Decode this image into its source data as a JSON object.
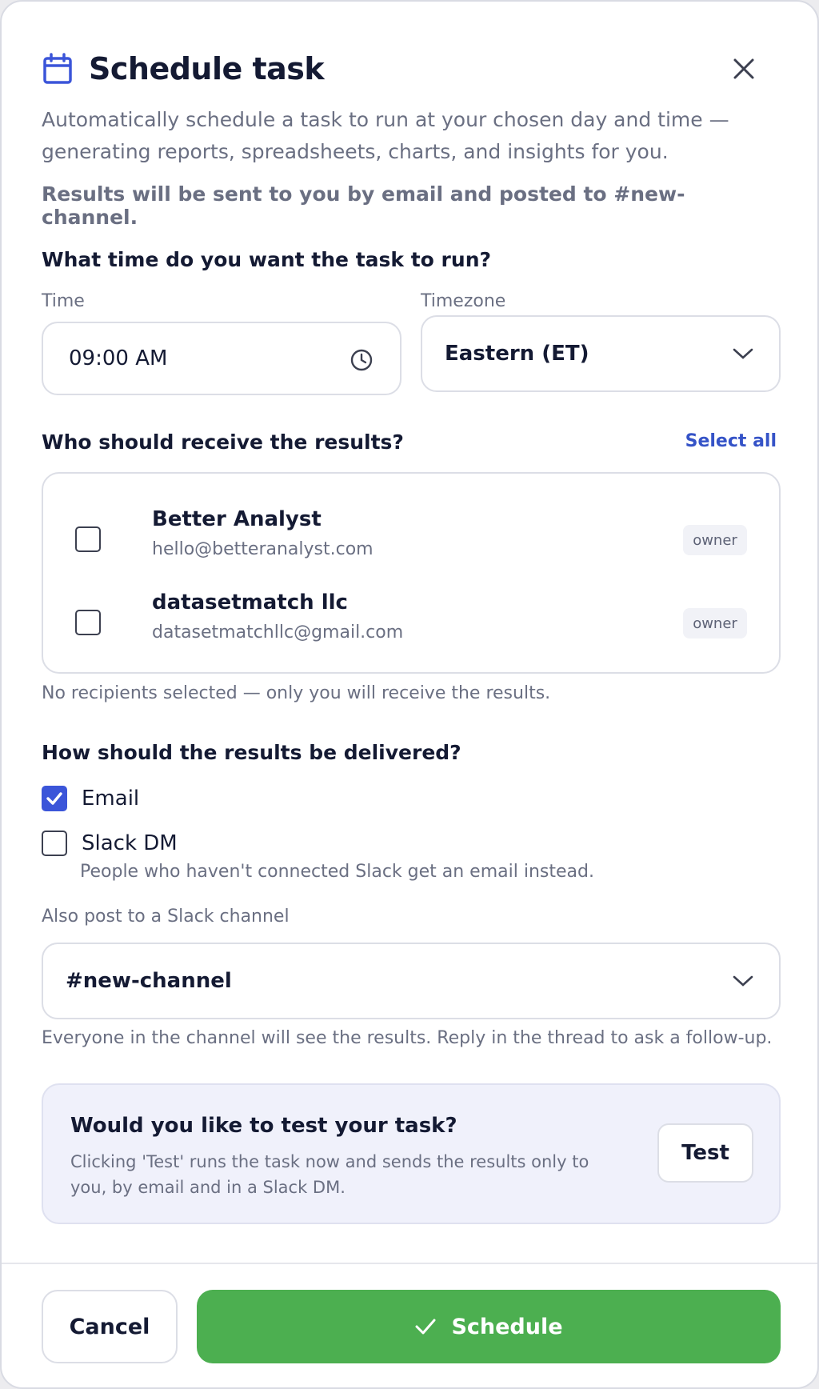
{
  "header": {
    "title": "Schedule task",
    "icons": {
      "calendar": "calendar-icon",
      "close": "close-icon"
    }
  },
  "description": "Automatically schedule a task to run at your chosen day and time — generating reports, spreadsheets, charts, and insights for you.",
  "results_note": "Results will be sent to you by email and posted to #new-channel.",
  "time_section": {
    "heading": "What time do you want the task to run?",
    "time_label": "Time",
    "time_value": "09:00 AM",
    "timezone_label": "Timezone",
    "timezone_value": "Eastern (ET)"
  },
  "recipients": {
    "heading": "Who should receive the results?",
    "select_all": "Select all",
    "items": [
      {
        "name": "Better Analyst",
        "email": "hello@betteranalyst.com",
        "role": "owner",
        "checked": false
      },
      {
        "name": "datasetmatch llc",
        "email": "datasetmatchllc@gmail.com",
        "role": "owner",
        "checked": false
      }
    ],
    "hint": "No recipients selected — only you will receive the results."
  },
  "delivery": {
    "heading": "How should the results be delivered?",
    "email_label": "Email",
    "email_checked": true,
    "slack_label": "Slack DM",
    "slack_checked": false,
    "slack_hint": "People who haven't connected Slack get an email instead.",
    "channel_label": "Also post to a Slack channel",
    "channel_value": "#new-channel",
    "channel_hint": "Everyone in the channel will see the results. Reply in the thread to ask a follow-up."
  },
  "test": {
    "title": "Would you like to test your task?",
    "description": "Clicking 'Test' runs the task now and sends the results only to you, by email and in a Slack DM.",
    "button": "Test"
  },
  "footer": {
    "cancel": "Cancel",
    "schedule": "Schedule"
  },
  "colors": {
    "primary": "#4caf50",
    "accent": "#3b55d9",
    "link": "#3553c7"
  }
}
